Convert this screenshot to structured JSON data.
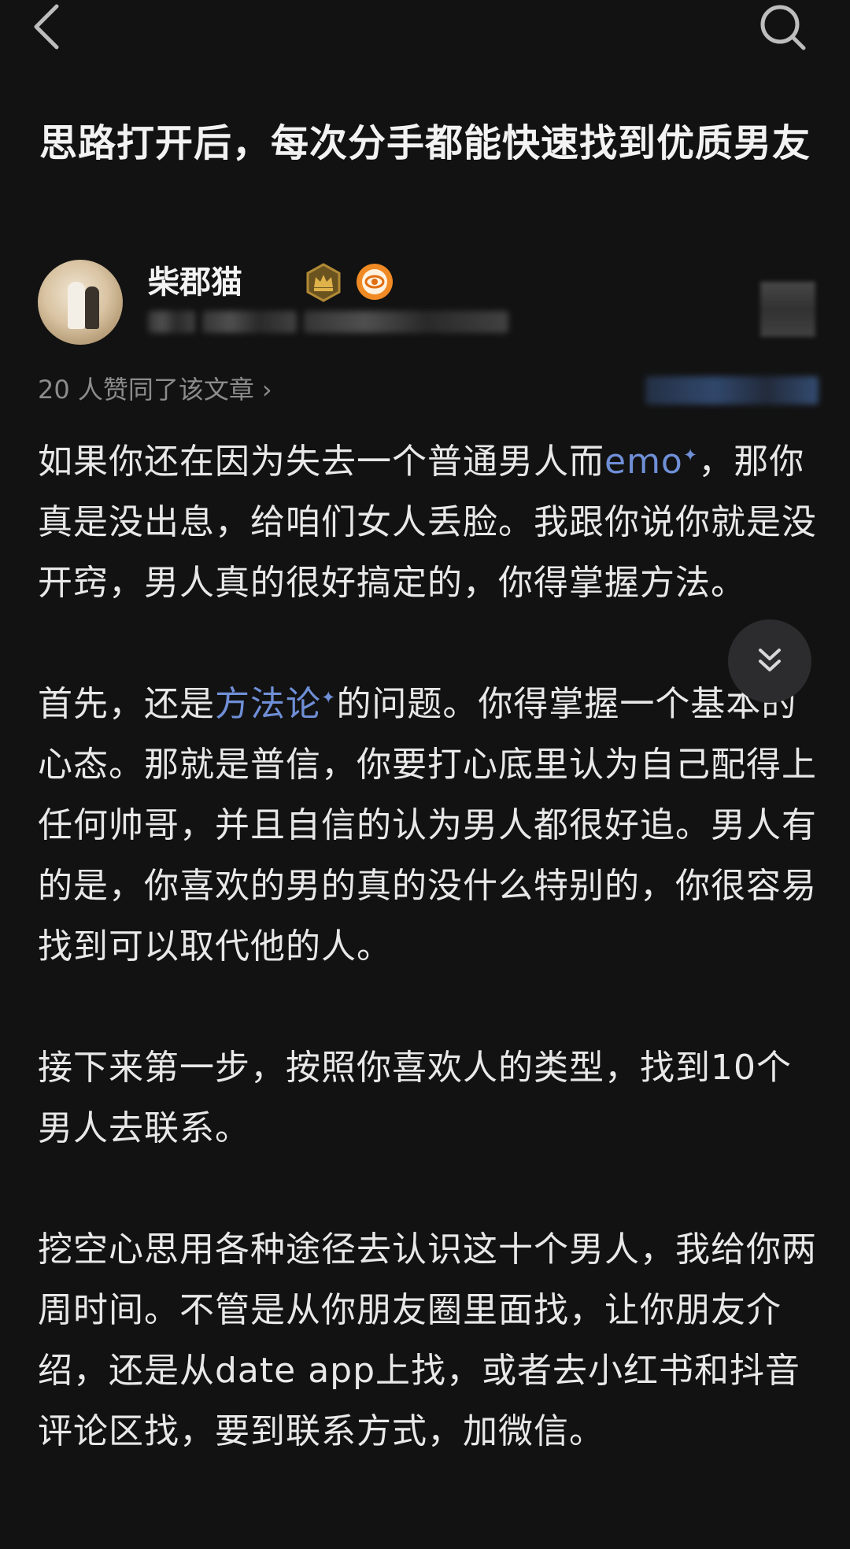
{
  "header": {
    "back_icon": "chevron-left-icon",
    "search_icon": "search-icon"
  },
  "article": {
    "title": "思路打开后，每次分手都能快速找到优质男友",
    "author": {
      "name": "柴郡猫",
      "badges": [
        "crown-badge-icon",
        "orange-eye-badge-icon"
      ]
    },
    "likes_text": "20 人赞同了该文章",
    "paragraphs": {
      "p1_a": "如果你还在因为失去一个普通男人而",
      "p1_link": "emo",
      "p1_b": "，那你真是没出息，给咱们女人丢脸。我跟你说你就是没开窍，男人真的很好搞定的，你得掌握方法。",
      "p2_a": "首先，还是",
      "p2_link": "方法论",
      "p2_b": "的问题。你得掌握一个基本的心态。那就是普信，你要打心底里认为自己配得上任何帅哥，并且自信的认为男人都很好追。男人有的是，你喜欢的男的真的没什么特别的，你很容易找到可以取代他的人。",
      "p3": "接下来第一步，按照你喜欢人的类型，找到10个男人去联系。",
      "p4": "挖空心思用各种途径去认识这十个男人，我给你两周时间。不管是从你朋友圈里面找，让你朋友介绍，还是从date app上找，或者去小红书和抖音评论区找，要到联系方式，加微信。"
    }
  },
  "colors": {
    "background": "#121212",
    "text": "#e8e8e8",
    "muted": "#8c8c8c",
    "link": "#6f8fd6"
  }
}
